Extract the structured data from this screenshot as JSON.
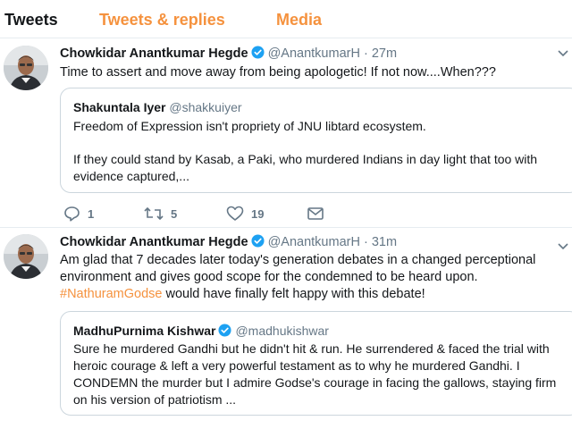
{
  "tabs": [
    {
      "label": "Tweets",
      "active": true
    },
    {
      "label": "Tweets & replies",
      "active": false
    },
    {
      "label": "Media",
      "active": false
    }
  ],
  "colors": {
    "accent": "#f5923e",
    "text": "#14171a",
    "muted": "#657786",
    "border": "#e6ecf0",
    "verified": "#1da1f2"
  },
  "tweets": [
    {
      "author_name": "Chowkidar Anantkumar Hegde",
      "verified": true,
      "handle": "@AnantkumarH",
      "separator": "·",
      "time": "27m",
      "text": "Time to assert and move away from being apologetic!  If not now....When???",
      "quote": {
        "author_name": "Shakuntala Iyer",
        "handle": "@shakkuiyer",
        "paragraph1": "Freedom of Expression isn't propriety of JNU libtard ecosystem.",
        "paragraph2": "If they could stand by Kasab, a Paki, who murdered Indians in day light that too with evidence captured,..."
      },
      "actions": {
        "replies": "1",
        "retweets": "5",
        "likes": "19"
      },
      "icons": [
        "reply-icon",
        "retweet-icon",
        "like-icon",
        "message-icon"
      ]
    },
    {
      "author_name": "Chowkidar Anantkumar Hegde",
      "verified": true,
      "handle": "@AnantkumarH",
      "separator": "·",
      "time": "31m",
      "text_before_hashtag": "Am glad that 7 decades later today's generation debates in a changed perceptional environment and gives good scope for the  condemned to be heard upon.  ",
      "hashtag": "#NathuramGodse",
      "text_after_hashtag": " would have finally felt happy with this debate!",
      "quote": {
        "author_name": "MadhuPurnima Kishwar",
        "verified": true,
        "handle": "@madhukishwar",
        "paragraph1": "Sure he murdered Gandhi but he didn't hit & run. He surrendered & faced the trial with heroic courage & left a very powerful testament as to why he murdered Gandhi. I CONDEMN the murder but I admire Godse's courage in facing the gallows, staying firm on his version of patriotism ..."
      }
    }
  ]
}
